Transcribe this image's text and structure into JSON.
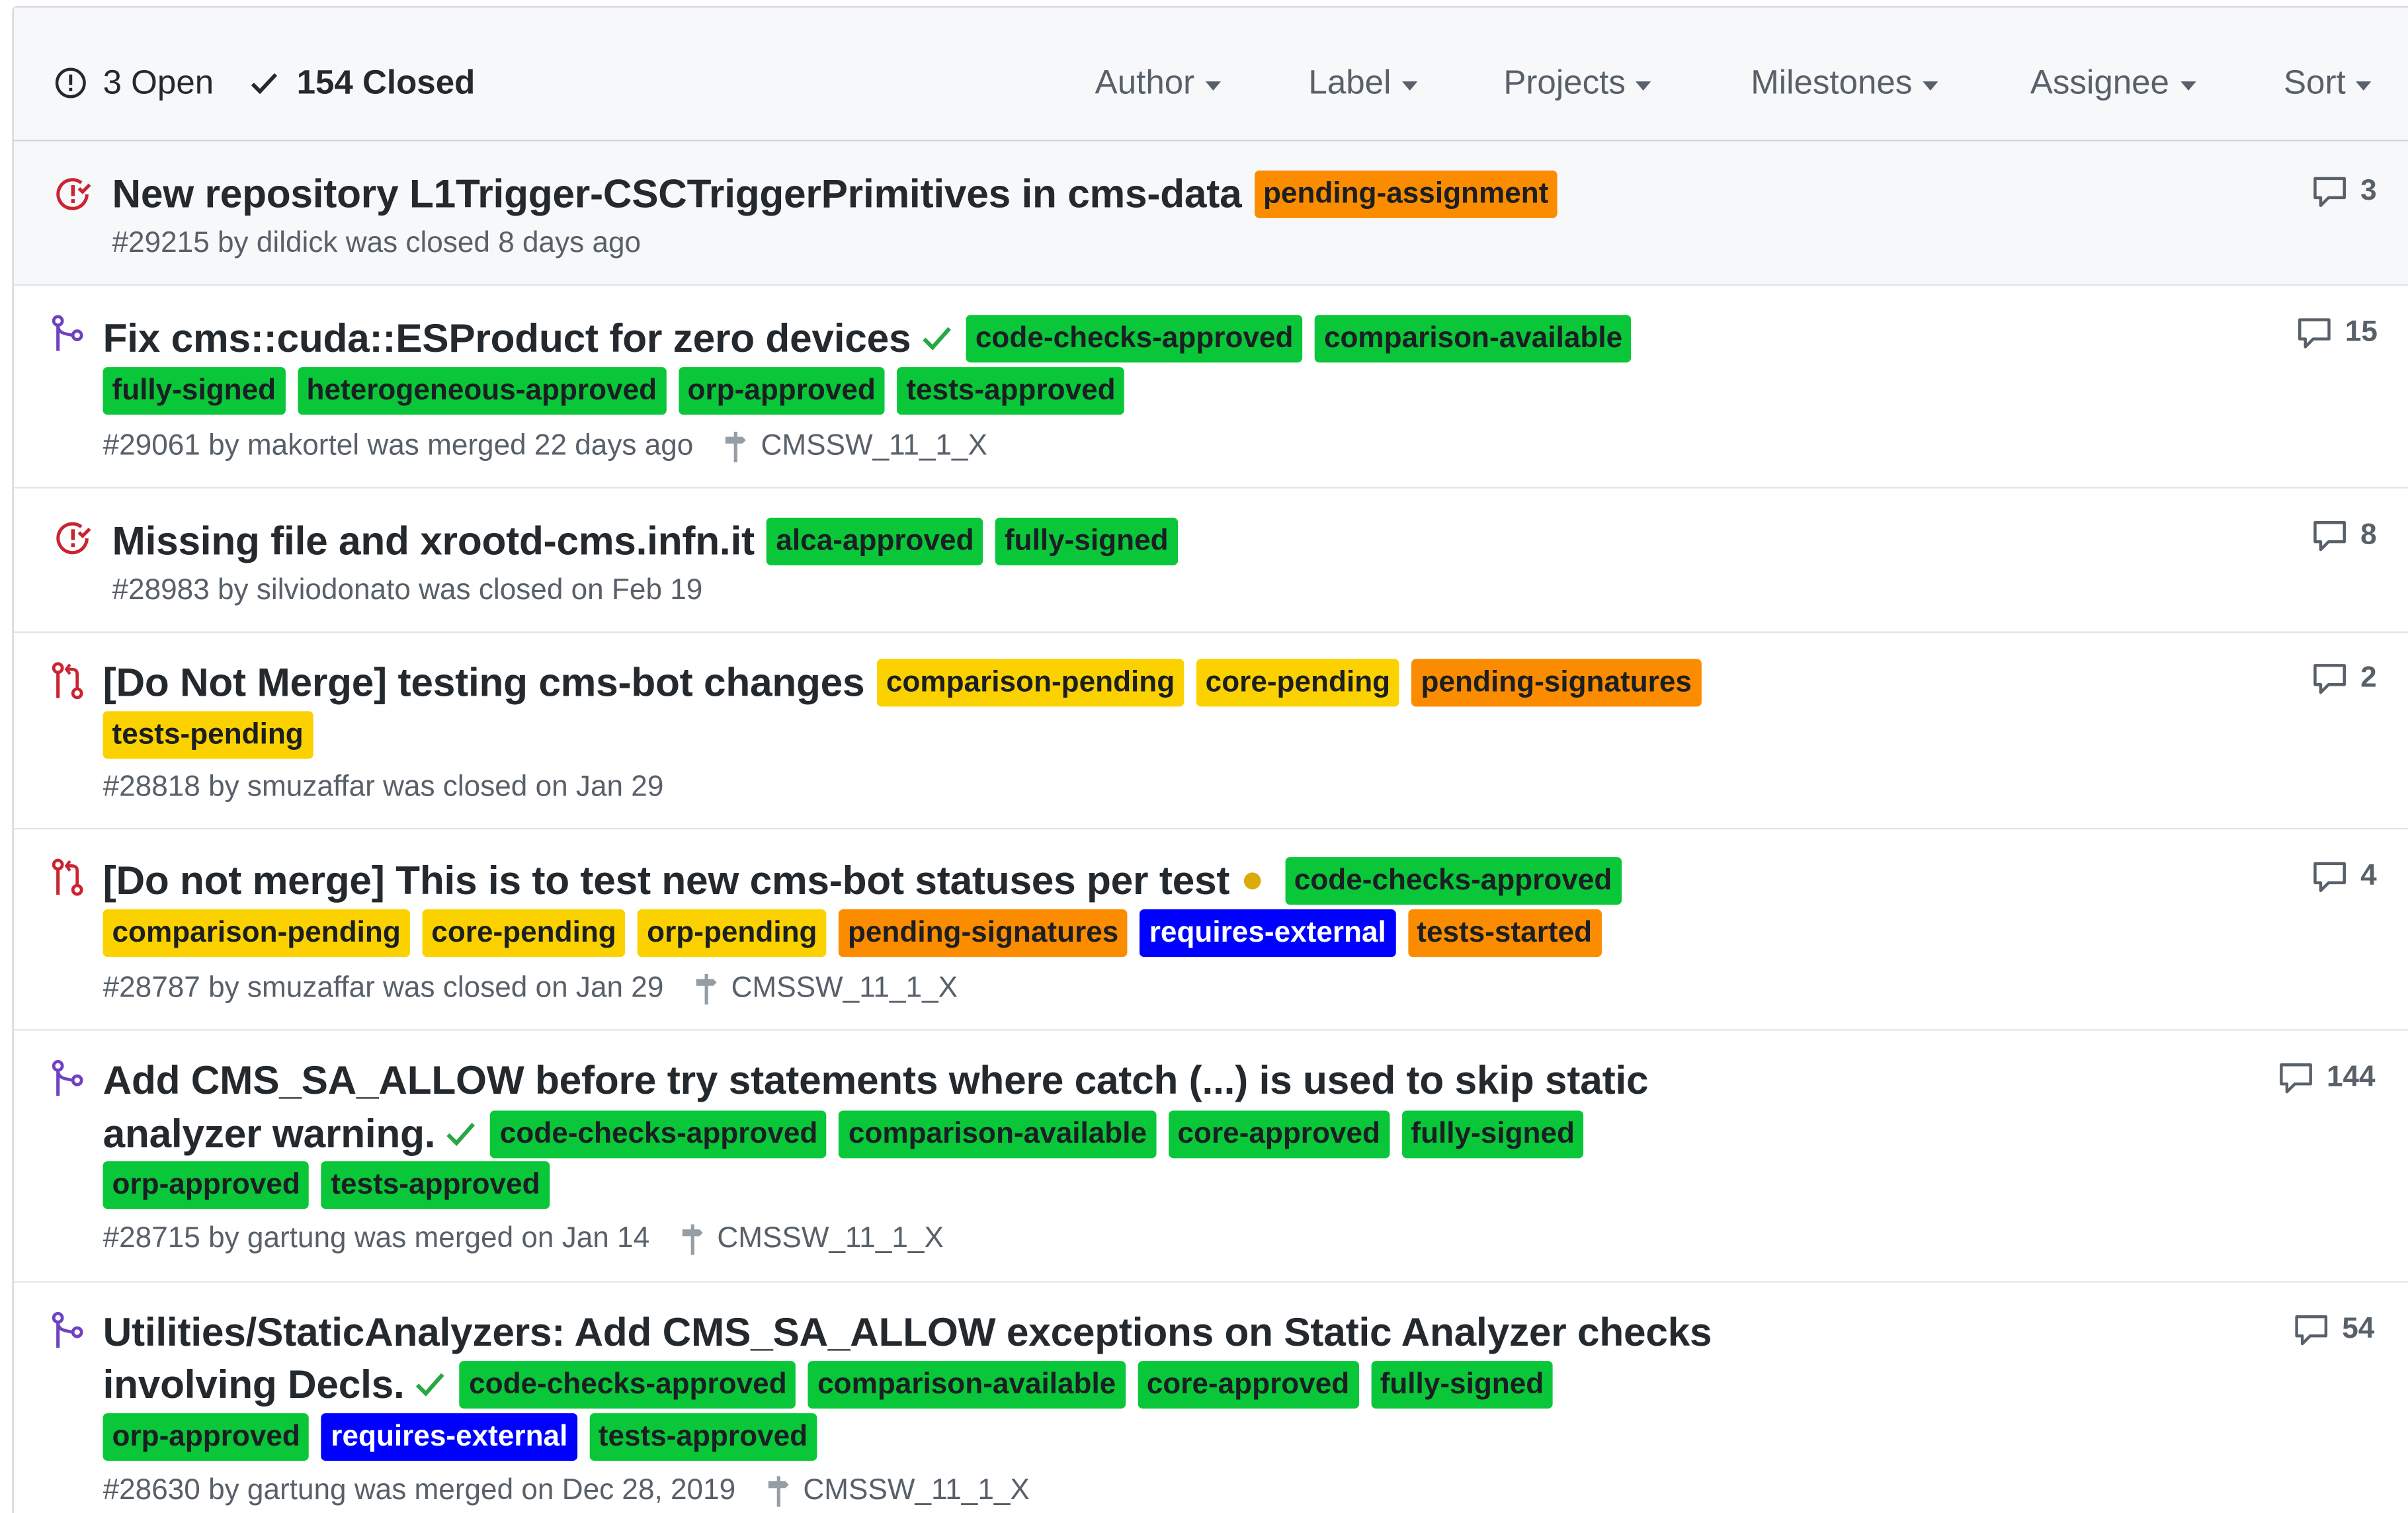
{
  "header": {
    "open_label": "3 Open",
    "closed_label": "154 Closed",
    "filters": [
      "Author",
      "Label",
      "Projects",
      "Milestones",
      "Assignee",
      "Sort"
    ]
  },
  "colors": {
    "green": "#0ac739",
    "orange": "#fb8c00",
    "yellow": "#fbd200",
    "blue": "#0000ff",
    "closed_issue_icon": "#cb2431",
    "merged_pr_icon": "#6f42c1",
    "closed_pr_icon": "#cb2431",
    "check": "#28a745",
    "pending_dot": "#dbab09"
  },
  "items": [
    {
      "icon": "closed-issue-icon",
      "title": "New repository L1Trigger-CSCTriggerPrimitives in cms-data",
      "labels": [
        {
          "text": "pending-assignment",
          "color": "orange"
        }
      ],
      "meta": "#29215 by dildick was closed 8 days ago",
      "comments": "3"
    },
    {
      "icon": "merged-pr-icon",
      "title": "Fix cms::cuda::ESProduct for zero devices",
      "status": "check",
      "labels": [
        {
          "text": "code-checks-approved",
          "color": "green"
        },
        {
          "text": "comparison-available",
          "color": "green"
        },
        {
          "text": "fully-signed",
          "color": "green"
        },
        {
          "text": "heterogeneous-approved",
          "color": "green"
        },
        {
          "text": "orp-approved",
          "color": "green"
        },
        {
          "text": "tests-approved",
          "color": "green"
        }
      ],
      "meta": "#29061 by makortel was merged 22 days ago",
      "milestone": "CMSSW_11_1_X",
      "comments": "15"
    },
    {
      "icon": "closed-issue-icon",
      "title": "Missing file and xrootd-cms.infn.it",
      "labels": [
        {
          "text": "alca-approved",
          "color": "green"
        },
        {
          "text": "fully-signed",
          "color": "green"
        }
      ],
      "meta": "#28983 by silviodonato was closed on Feb 19",
      "comments": "8"
    },
    {
      "icon": "closed-pr-icon",
      "title": "[Do Not Merge] testing cms-bot changes",
      "labels": [
        {
          "text": "comparison-pending",
          "color": "yellow"
        },
        {
          "text": "core-pending",
          "color": "yellow"
        },
        {
          "text": "pending-signatures",
          "color": "orange"
        },
        {
          "text": "tests-pending",
          "color": "yellow"
        }
      ],
      "meta": "#28818 by smuzaffar was closed on Jan 29",
      "comments": "2"
    },
    {
      "icon": "closed-pr-icon",
      "title": "[Do not merge] This is to test new cms-bot statuses per test",
      "status": "pending",
      "labels": [
        {
          "text": "code-checks-approved",
          "color": "green"
        },
        {
          "text": "comparison-pending",
          "color": "yellow"
        },
        {
          "text": "core-pending",
          "color": "yellow"
        },
        {
          "text": "orp-pending",
          "color": "yellow"
        },
        {
          "text": "pending-signatures",
          "color": "orange"
        },
        {
          "text": "requires-external",
          "color": "blue"
        },
        {
          "text": "tests-started",
          "color": "orange"
        }
      ],
      "meta": "#28787 by smuzaffar was closed on Jan 29",
      "milestone": "CMSSW_11_1_X",
      "comments": "4"
    },
    {
      "icon": "merged-pr-icon",
      "title_line1": "Add CMS_SA_ALLOW before try statements where catch (...) is used to skip static",
      "title_line2": "analyzer warning.",
      "status": "check",
      "labels": [
        {
          "text": "code-checks-approved",
          "color": "green"
        },
        {
          "text": "comparison-available",
          "color": "green"
        },
        {
          "text": "core-approved",
          "color": "green"
        },
        {
          "text": "fully-signed",
          "color": "green"
        },
        {
          "text": "orp-approved",
          "color": "green"
        },
        {
          "text": "tests-approved",
          "color": "green"
        }
      ],
      "meta": "#28715 by gartung was merged on Jan 14",
      "milestone": "CMSSW_11_1_X",
      "comments": "144"
    },
    {
      "icon": "merged-pr-icon",
      "title_line1": "Utilities/StaticAnalyzers: Add CMS_SA_ALLOW exceptions on Static Analyzer checks",
      "title_line2": "involving Decls.",
      "status": "check",
      "labels": [
        {
          "text": "code-checks-approved",
          "color": "green"
        },
        {
          "text": "comparison-available",
          "color": "green"
        },
        {
          "text": "core-approved",
          "color": "green"
        },
        {
          "text": "fully-signed",
          "color": "green"
        },
        {
          "text": "orp-approved",
          "color": "green"
        },
        {
          "text": "requires-external",
          "color": "blue"
        },
        {
          "text": "tests-approved",
          "color": "green"
        }
      ],
      "meta": "#28630 by gartung was merged on Dec 28, 2019",
      "milestone": "CMSSW_11_1_X",
      "comments": "54"
    }
  ]
}
